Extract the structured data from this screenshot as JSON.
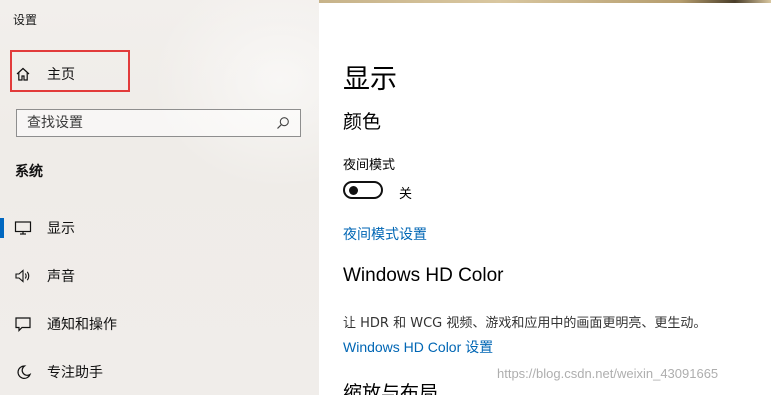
{
  "window": {
    "title": "设置"
  },
  "sidebar": {
    "home_label": "主页",
    "search": {
      "placeholder": "查找设置",
      "value": ""
    },
    "section_title": "系统",
    "items": [
      {
        "label": "显示",
        "icon": "monitor-icon",
        "active": true
      },
      {
        "label": "声音",
        "icon": "speaker-icon",
        "active": false
      },
      {
        "label": "通知和操作",
        "icon": "notification-icon",
        "active": false
      },
      {
        "label": "专注助手",
        "icon": "moon-icon",
        "active": false
      }
    ]
  },
  "main": {
    "title": "显示",
    "color_heading": "颜色",
    "night_mode": {
      "label": "夜间模式",
      "state": "关",
      "on": false
    },
    "night_mode_settings_link": "夜间模式设置",
    "hd_color": {
      "heading": "Windows HD Color",
      "description": "让 HDR 和 WCG 视频、游戏和应用中的画面更明亮、更生动。",
      "link": "Windows HD Color 设置"
    },
    "next_heading": "缩放与布局"
  },
  "watermark": "https://blog.csdn.net/weixin_43091665",
  "colors": {
    "accent": "#0067c0",
    "link": "#0066b4",
    "highlight_box": "#e23b3b"
  }
}
